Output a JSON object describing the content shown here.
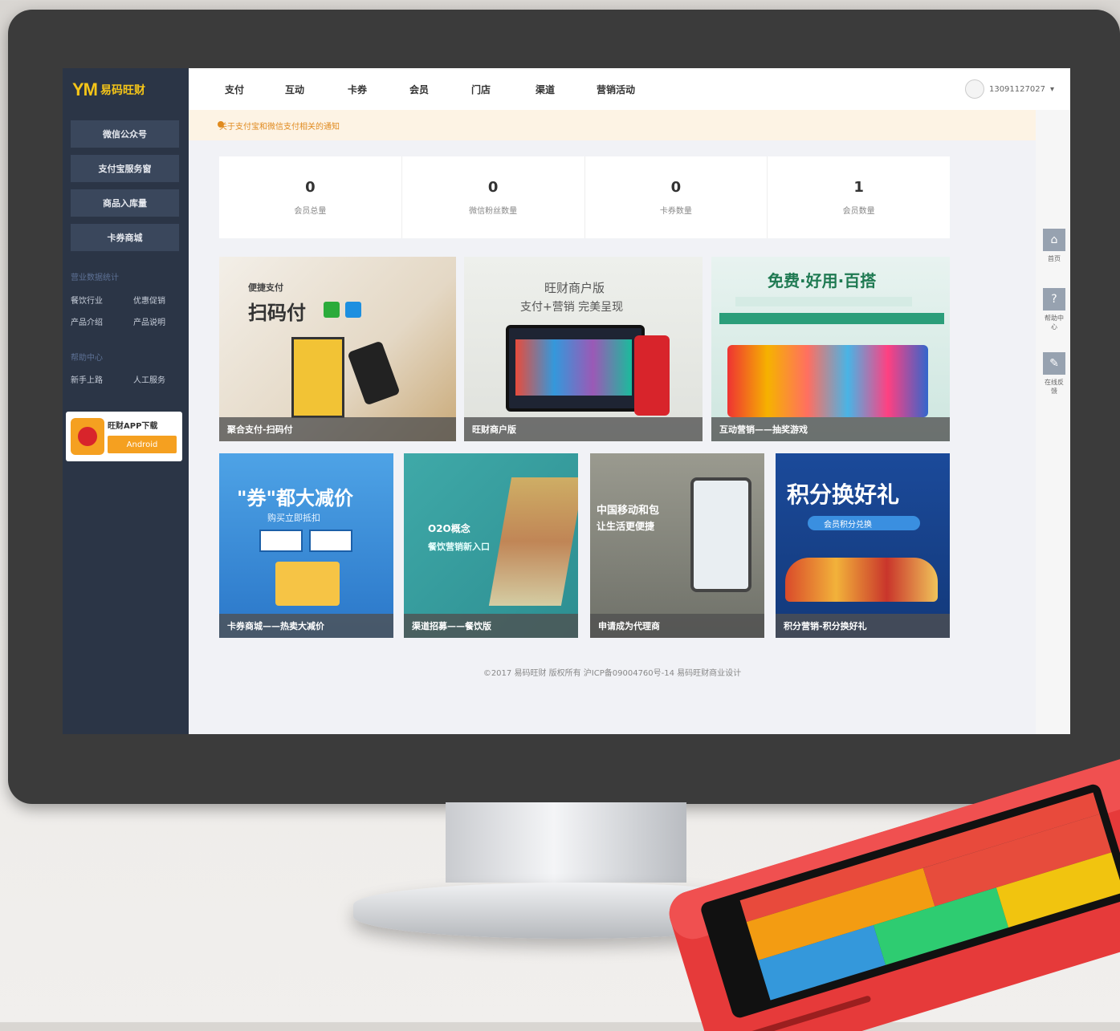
{
  "brand": {
    "logo_mark": "YM",
    "logo_text": "易码旺财"
  },
  "sidebar": {
    "buttons": [
      "微信公众号",
      "支付宝服务窗",
      "商品入库量",
      "卡券商城"
    ],
    "section1_title": "营业数据统计",
    "section1_links": [
      "餐饮行业",
      "优惠促销",
      "产品介绍",
      "产品说明"
    ],
    "section2_title": "帮助中心",
    "section2_links": [
      "新手上路",
      "人工服务"
    ],
    "app": {
      "title": "旺财APP下载",
      "button": "Android"
    }
  },
  "topnav": {
    "items": [
      "支付",
      "互动",
      "卡券",
      "会员",
      "门店",
      "渠道",
      "营销活动"
    ],
    "user": "13091127027"
  },
  "notice": "关于支付宝和微信支付相关的通知",
  "stats": [
    {
      "value": "0",
      "label": "会员总量"
    },
    {
      "value": "0",
      "label": "微信粉丝数量"
    },
    {
      "value": "0",
      "label": "卡券数量"
    },
    {
      "value": "1",
      "label": "会员数量"
    }
  ],
  "cards": [
    {
      "caption": "聚合支付-扫码付",
      "headline": "扫码付",
      "sub": "便捷支付"
    },
    {
      "caption": "旺财商户版",
      "headline": "旺财商户版",
      "sub": "支付+营销 完美呈现"
    },
    {
      "caption": "互动营销——抽奖游戏",
      "headline": "免费·好用·百搭",
      "sub": ""
    },
    {
      "caption": "卡券商城——热卖大减价",
      "headline": "\"券\"都大减价",
      "sub": "购买立即抵扣"
    },
    {
      "caption": "渠道招募——餐饮版",
      "headline": "O2O概念",
      "sub": "餐饮营销新入口"
    },
    {
      "caption": "申请成为代理商",
      "headline": "中国移动和包",
      "sub": "让生活更便捷"
    },
    {
      "caption": "积分营销-积分换好礼",
      "headline": "积分换好礼",
      "sub": "会员积分兑换"
    }
  ],
  "footer": "©2017 易码旺财 版权所有 沪ICP备09004760号-14   易码旺财商业设计",
  "rightbar": [
    {
      "icon": "home-icon",
      "glyph": "⌂",
      "label": "首页"
    },
    {
      "icon": "help-icon",
      "glyph": "?",
      "label": "帮助中心"
    },
    {
      "icon": "edit-icon",
      "glyph": "✎",
      "label": "在线反馈"
    }
  ],
  "colors": {
    "sidebar": "#2b3546",
    "accent": "#f5a020",
    "notice": "#e08a1e"
  }
}
